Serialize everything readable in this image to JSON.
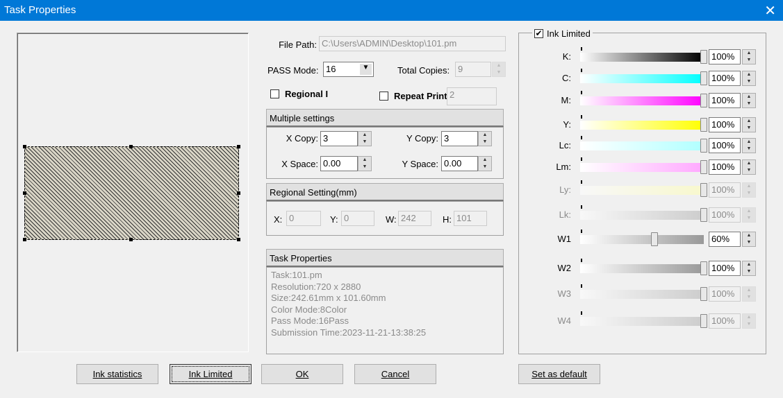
{
  "title": "Task Properties",
  "file_path": {
    "label": "File Path:",
    "value": "C:\\Users\\ADMIN\\Desktop\\101.pm"
  },
  "pass_mode": {
    "label": "PASS Mode:",
    "value": "16"
  },
  "total_copies": {
    "label": "Total Copies:",
    "value": "9"
  },
  "regional": {
    "label": "Regional I",
    "checked": false
  },
  "repeat_print": {
    "label": "Repeat Print",
    "checked": false,
    "value": "2"
  },
  "multiple": {
    "header": "Multiple settings",
    "x_copy_label": "X Copy:",
    "x_copy": "3",
    "y_copy_label": "Y Copy:",
    "y_copy": "3",
    "x_space_label": "X Space:",
    "x_space": "0.00",
    "y_space_label": "Y Space:",
    "y_space": "0.00"
  },
  "regional_setting": {
    "header": "Regional Setting(mm)",
    "x_label": "X:",
    "x": "0",
    "y_label": "Y:",
    "y": "0",
    "w_label": "W:",
    "w": "242",
    "h_label": "H:",
    "h": "101"
  },
  "task_props": {
    "header": "Task Properties",
    "lines": [
      "Task:101.pm",
      "Resolution:720 x 2880",
      "Size:242.61mm x 101.60mm",
      "Color Mode:8Color",
      "Pass Mode:16Pass",
      "Submission Time:2023-11-21-13:38:25"
    ]
  },
  "ink_limited": {
    "label": "Ink Limited",
    "checked": true,
    "channels": [
      {
        "label": "K:",
        "value": "100%",
        "level": 100,
        "color": "#000000",
        "enabled": true
      },
      {
        "label": "C:",
        "value": "100%",
        "level": 100,
        "color": "#00ffff",
        "enabled": true
      },
      {
        "label": "M:",
        "value": "100%",
        "level": 100,
        "color": "#ff00ff",
        "enabled": true
      },
      {
        "label": "Y:",
        "value": "100%",
        "level": 100,
        "color": "#ffff00",
        "enabled": true
      },
      {
        "label": "Lc:",
        "value": "100%",
        "level": 100,
        "color": "#b0ffff",
        "enabled": true
      },
      {
        "label": "Lm:",
        "value": "100%",
        "level": 100,
        "color": "#ffa8ff",
        "enabled": true
      },
      {
        "label": "Ly:",
        "value": "100%",
        "level": 100,
        "color": "#ffffb0",
        "enabled": false
      },
      {
        "label": "Lk:",
        "value": "100%",
        "level": 100,
        "color": "#a0a0a0",
        "enabled": false
      },
      {
        "label": "W1",
        "value": "60%",
        "level": 60,
        "color": "#a0a0a0",
        "enabled": true
      },
      {
        "label": "W2",
        "value": "100%",
        "level": 100,
        "color": "#a0a0a0",
        "enabled": true
      },
      {
        "label": "W3",
        "value": "100%",
        "level": 100,
        "color": "#a0a0a0",
        "enabled": false
      },
      {
        "label": "W4",
        "value": "100%",
        "level": 100,
        "color": "#a0a0a0",
        "enabled": false
      }
    ]
  },
  "buttons": {
    "ink_statistics": "Ink statistics",
    "ink_limited": "Ink Limited",
    "ok": "OK",
    "cancel": "Cancel",
    "set_default": "Set as default"
  }
}
